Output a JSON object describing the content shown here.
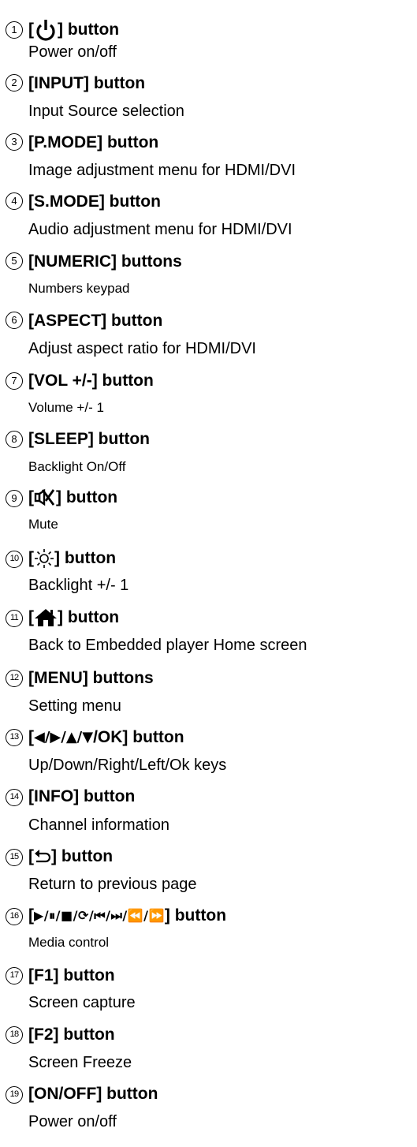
{
  "items": [
    {
      "number": "1",
      "title_pre": "[ ",
      "icon": "power-icon",
      "title_post": " ] button",
      "description": "Power on/off"
    },
    {
      "number": "2",
      "title": "[INPUT] button",
      "description": "Input Source selection"
    },
    {
      "number": "3",
      "title": "[P.MODE] button",
      "description": "Image adjustment menu for HDMI/DVI"
    },
    {
      "number": "4",
      "title": "[S.MODE] button",
      "description": "Audio adjustment menu for HDMI/DVI"
    },
    {
      "number": "5",
      "title": "[NUMERIC] buttons",
      "description": "Numbers keypad"
    },
    {
      "number": "6",
      "title": "[ASPECT] button",
      "description": "Adjust aspect ratio for HDMI/DVI"
    },
    {
      "number": "7",
      "title": "[VOL +/-] button",
      "description": "Volume +/- 1"
    },
    {
      "number": "8",
      "title": "[SLEEP] button",
      "description": "Backlight On/Off"
    },
    {
      "number": "9",
      "title_pre": "[ ",
      "icon": "mute-icon",
      "title_post": " ] button",
      "description": "Mute"
    },
    {
      "number": "10",
      "title_pre": "[ ",
      "icon": "brightness-icon",
      "title_post": " ] button",
      "description": "Backlight +/- 1"
    },
    {
      "number": "11",
      "title_pre": "[ ",
      "icon": "home-icon",
      "title_post": " ] button",
      "description": "Back to Embedded player Home screen"
    },
    {
      "number": "12",
      "title": "[MENU] buttons",
      "description": "Setting menu"
    },
    {
      "number": "13",
      "title_pre": "[",
      "title_symbols": "◀/▶/▲/▼",
      "title_post": "/OK] button",
      "description": "Up/Down/Right/Left/Ok keys"
    },
    {
      "number": "14",
      "title": "[INFO] button",
      "description": "Channel information"
    },
    {
      "number": "15",
      "title_pre": "[ ",
      "icon": "return-icon",
      "title_post": " ] button",
      "description": "Return to previous page"
    },
    {
      "number": "16",
      "title_pre": "[ ",
      "title_symbols": "▶/⏸/■/⟳/⏮/⏭/⏪/⏩",
      "title_post": " ] button",
      "description": "Media control"
    },
    {
      "number": "17",
      "title": "[F1] button",
      "description": "Screen capture"
    },
    {
      "number": "18",
      "title": "[F2] button",
      "description": "Screen Freeze"
    },
    {
      "number": "19",
      "title": "[ON/OFF] button",
      "description": "Power on/off"
    }
  ]
}
